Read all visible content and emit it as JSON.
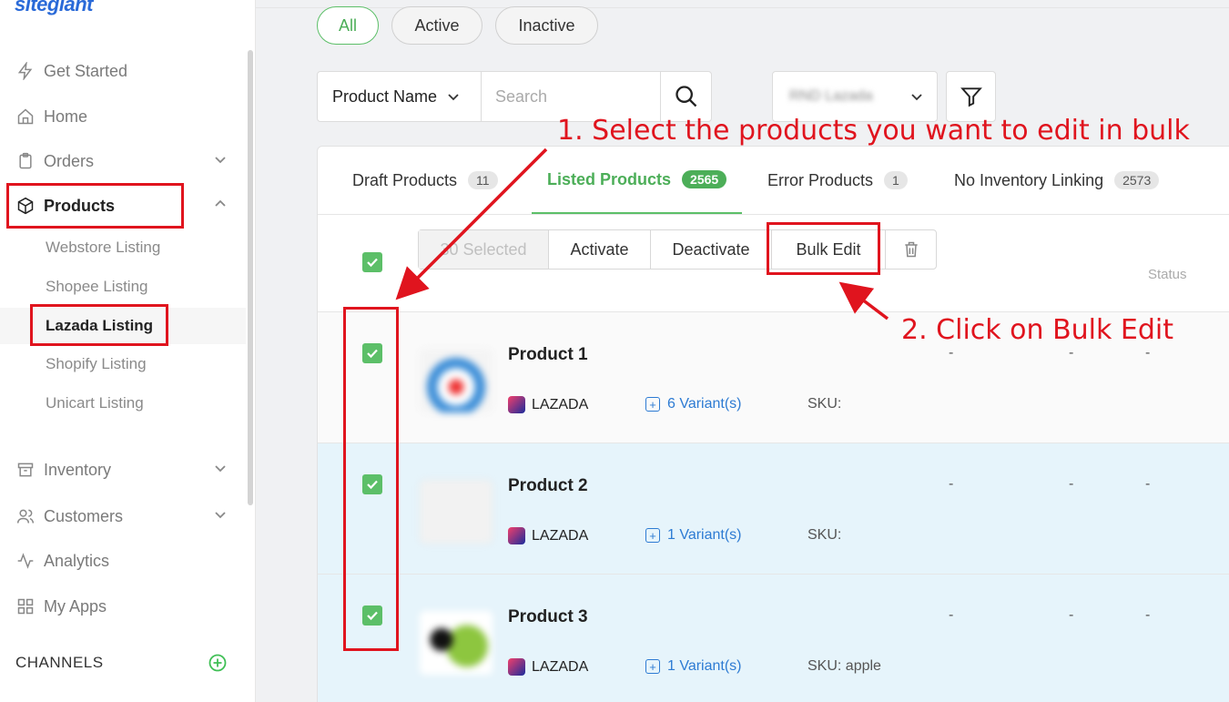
{
  "sidebar": {
    "logo": "sitegiant",
    "nav": [
      {
        "label": "Get Started",
        "icon": "bolt-icon"
      },
      {
        "label": "Home",
        "icon": "home-icon"
      },
      {
        "label": "Orders",
        "icon": "clipboard-icon"
      },
      {
        "label": "Products",
        "icon": "box-icon"
      },
      {
        "label": "Inventory",
        "icon": "archive-icon"
      },
      {
        "label": "Customers",
        "icon": "users-icon"
      },
      {
        "label": "Analytics",
        "icon": "activity-icon"
      },
      {
        "label": "My Apps",
        "icon": "grid-icon"
      }
    ],
    "sub": [
      "Webstore Listing",
      "Shopee Listing",
      "Lazada Listing",
      "Shopify Listing",
      "Unicart Listing"
    ],
    "channels": "CHANNELS"
  },
  "filters": {
    "pills": [
      "All",
      "Active",
      "Inactive"
    ],
    "field": "Product Name",
    "search_placeholder": "Search",
    "store": "RND Lazada"
  },
  "tabs": [
    {
      "label": "Draft Products",
      "count": "11"
    },
    {
      "label": "Listed Products",
      "count": "2565"
    },
    {
      "label": "Error Products",
      "count": "1"
    },
    {
      "label": "No Inventory Linking",
      "count": "2573"
    }
  ],
  "bulk": {
    "selected": "30 Selected",
    "activate": "Activate",
    "deactivate": "Deactivate",
    "bulk_edit": "Bulk Edit",
    "status_header": "Status"
  },
  "products": [
    {
      "name": "Product 1",
      "platform": "LAZADA",
      "variants": "6 Variant(s)",
      "sku": "SKU:"
    },
    {
      "name": "Product 2",
      "platform": "LAZADA",
      "variants": "1 Variant(s)",
      "sku": "SKU:"
    },
    {
      "name": "Product 3",
      "platform": "LAZADA",
      "variants": "1 Variant(s)",
      "sku": "SKU: apple"
    }
  ],
  "dash": "-",
  "annotations": {
    "step1": "1. Select the products you want to edit in bulk",
    "step2": "2. Click on Bulk Edit"
  },
  "colors": {
    "accent": "#5cbf68",
    "annotation": "#e0141e",
    "link": "#2d7bd3"
  }
}
